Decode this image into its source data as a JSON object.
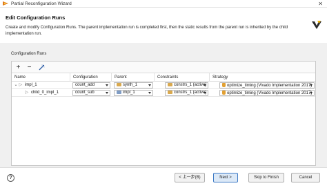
{
  "window": {
    "title": "Partial Reconfiguration Wizard",
    "close_glyph": "✕"
  },
  "header": {
    "title": "Edit Configuration Runs",
    "description": "Create and modify Configuration Runs. The parent implementation run is completed first, then the static results from the parent run is inherited by the child implementation run."
  },
  "section": {
    "label": "Configuration Runs"
  },
  "toolbar": {
    "add_glyph": "+",
    "remove_glyph": "−",
    "auto_icon": "wand-icon"
  },
  "table": {
    "columns": [
      "Name",
      "Configuration",
      "Parent",
      "Constraints",
      "Strategy"
    ],
    "rows": [
      {
        "expand_glyph": "⌄",
        "run_glyph": "▷",
        "name": "impl_1",
        "configuration": "count_add",
        "parent": "synth_1",
        "constraints": "constrs_1 (active)",
        "strategy": "optimize_timing (Vivado Implementation 2017)"
      },
      {
        "expand_glyph": "",
        "run_glyph": "▷",
        "name": "child_0_impl_1",
        "configuration": "count_sub",
        "parent": "impl_1",
        "constraints": "constrs_1 (active)",
        "strategy": "optimize_timing (Vivado Implementation 2017)"
      }
    ]
  },
  "footer": {
    "help_glyph": "?",
    "back_label": "< 上一步(B)",
    "next_label": "Next >",
    "skip_label": "Skip to Finish",
    "cancel_label": "Cancel"
  }
}
